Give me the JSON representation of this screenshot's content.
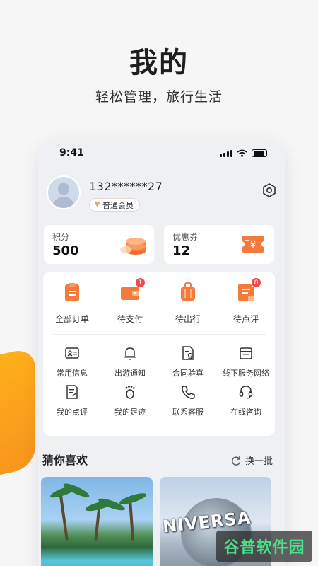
{
  "hero": {
    "title": "我的",
    "subtitle": "轻松管理，旅行生活"
  },
  "status_bar": {
    "time": "9:41"
  },
  "profile": {
    "phone": "132******27",
    "member_level": "普通会员"
  },
  "points": {
    "label": "积分",
    "value": "500"
  },
  "coupons": {
    "label": "优惠券",
    "value": "12"
  },
  "orders": [
    {
      "label": "全部订单",
      "icon": "clipboard-icon"
    },
    {
      "label": "待支付",
      "icon": "wallet-icon",
      "badge": "1"
    },
    {
      "label": "待出行",
      "icon": "suitcase-icon"
    },
    {
      "label": "待点评",
      "icon": "review-icon",
      "badge": "8"
    }
  ],
  "services": [
    {
      "label": "常用信息",
      "icon": "id-card-icon"
    },
    {
      "label": "出游通知",
      "icon": "bell-icon"
    },
    {
      "label": "合同验真",
      "icon": "contract-icon"
    },
    {
      "label": "线下服务网络",
      "icon": "store-icon"
    },
    {
      "label": "我的点评",
      "icon": "edit-note-icon"
    },
    {
      "label": "我的足迹",
      "icon": "footprint-icon"
    },
    {
      "label": "联系客服",
      "icon": "phone-icon"
    },
    {
      "label": "在线咨询",
      "icon": "headset-icon"
    }
  ],
  "recommend": {
    "title": "猜你喜欢",
    "refresh_label": "换一批"
  },
  "photos": {
    "right_sign_text": "NIVERSA"
  },
  "watermark": "谷普软件园",
  "colors": {
    "accent": "#f47a3c",
    "badge": "#f04848",
    "deco": "#f7a21b",
    "watermark_text": "#4be08a"
  }
}
